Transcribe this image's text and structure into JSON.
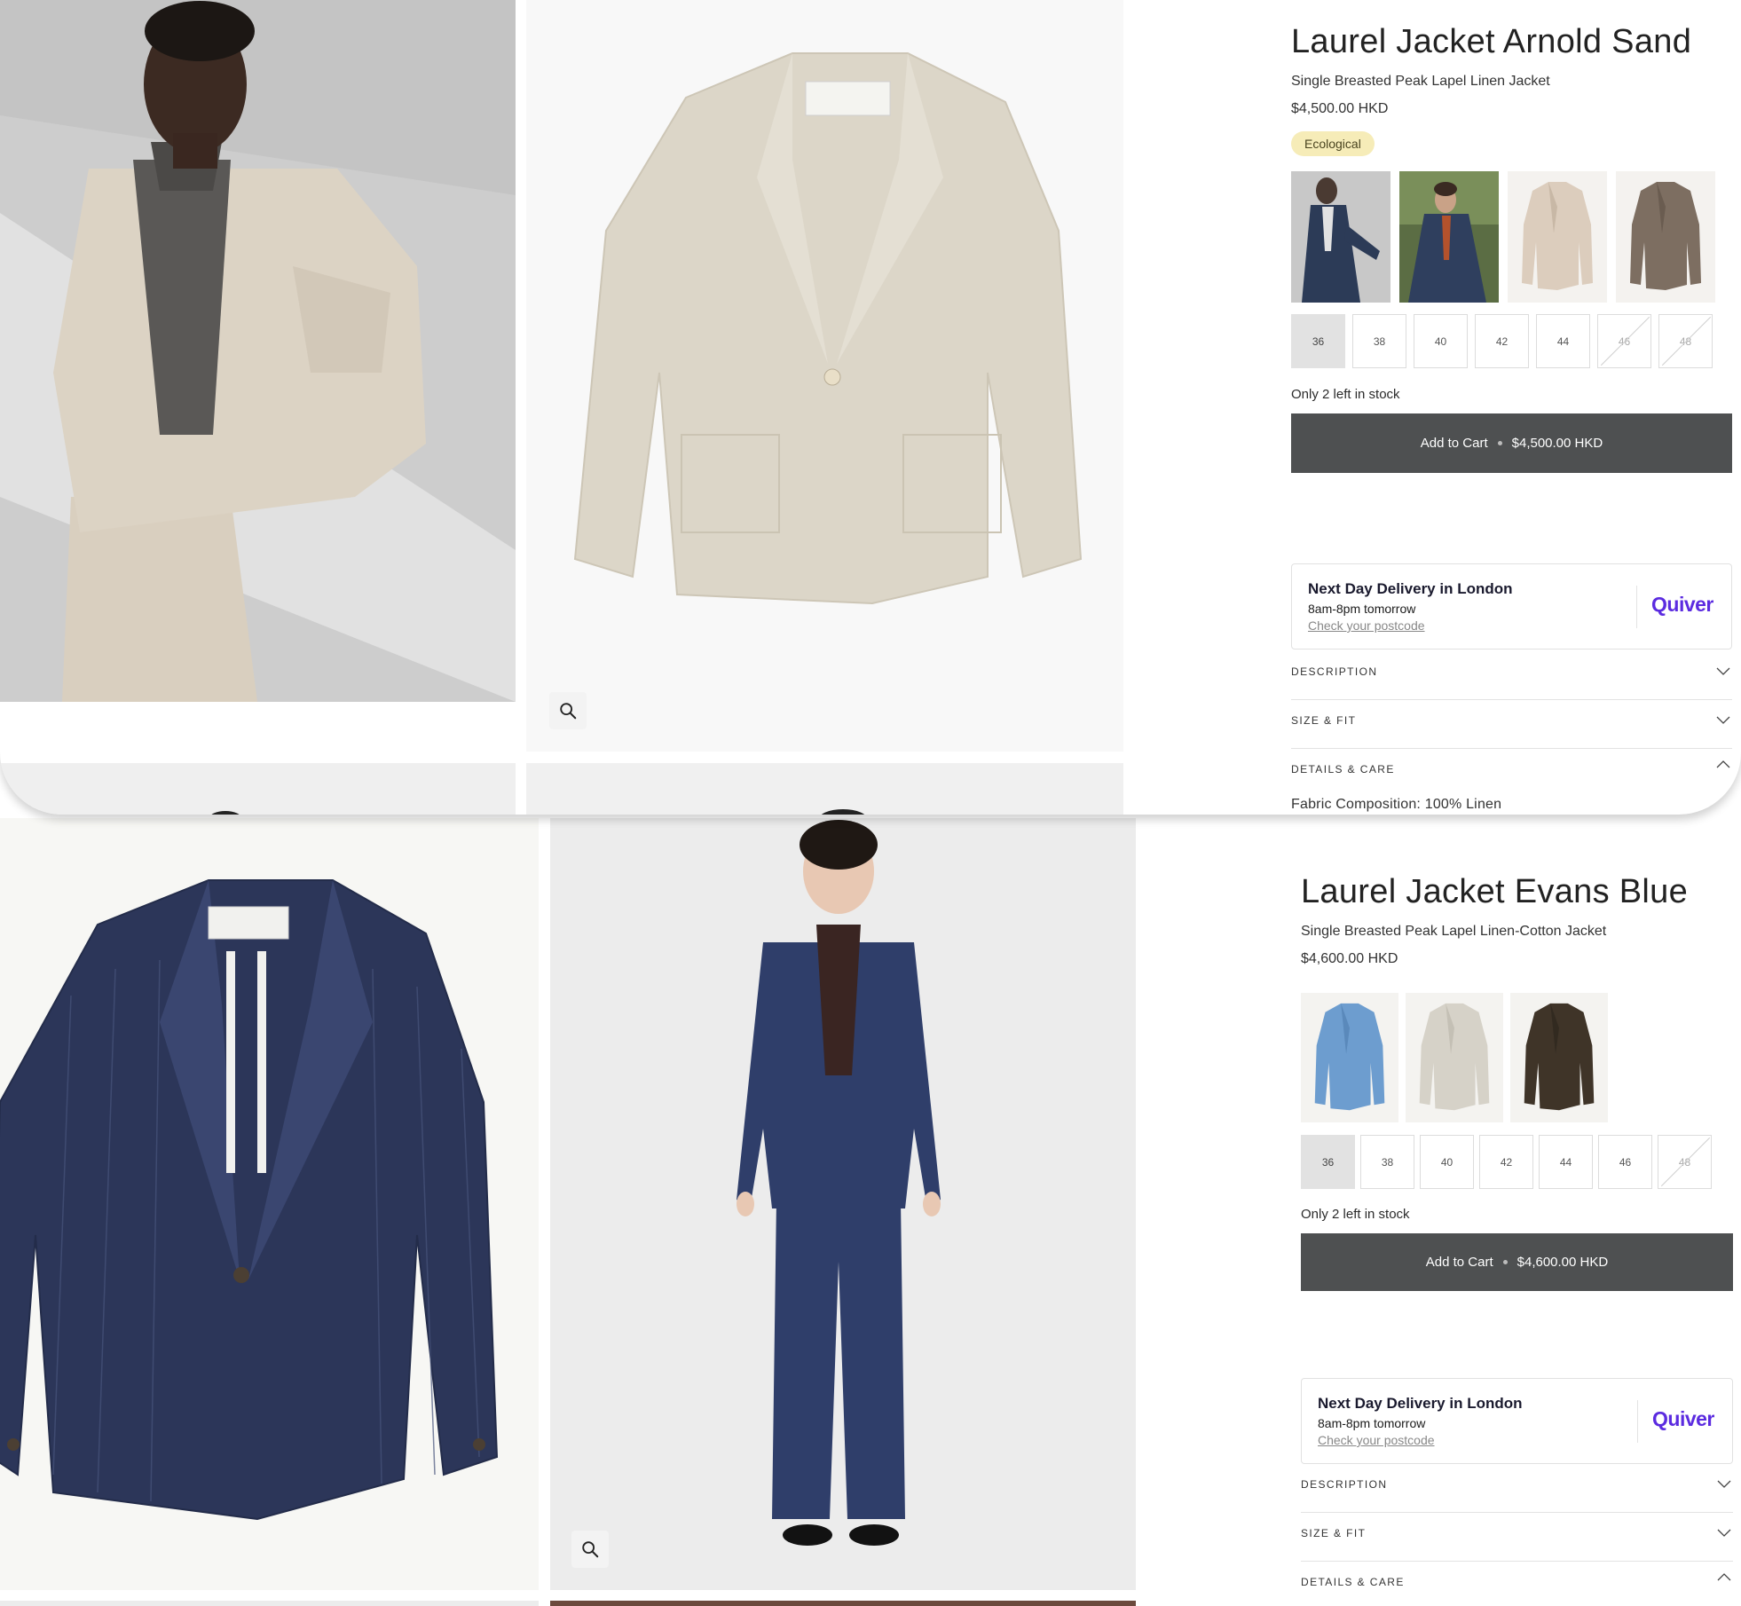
{
  "products": [
    {
      "title": "Laurel Jacket Arnold Sand",
      "subtitle": "Single Breasted Peak Lapel Linen Jacket",
      "price": "$4,500.00 HKD",
      "badge": "Ecological",
      "swatches": [
        "navy suit worn by model",
        "navy suit model seated outdoors",
        "beige jacket",
        "brown jacket"
      ],
      "sizes": [
        {
          "label": "36",
          "state": "selected"
        },
        {
          "label": "38",
          "state": "available"
        },
        {
          "label": "40",
          "state": "available"
        },
        {
          "label": "42",
          "state": "available"
        },
        {
          "label": "44",
          "state": "available"
        },
        {
          "label": "46",
          "state": "unavailable"
        },
        {
          "label": "48",
          "state": "unavailable"
        }
      ],
      "stock": "Only 2 left in stock",
      "cart_label": "Add to Cart",
      "cart_price": "$4,500.00 HKD",
      "delivery": {
        "title": "Next Day Delivery in London",
        "time": "8am-8pm tomorrow",
        "link": "Check your postcode",
        "logo": "Quiver"
      },
      "accordion": [
        "DESCRIPTION",
        "SIZE & FIT",
        "DETAILS & CARE"
      ],
      "fabric": "Fabric Composition: 100% Linen"
    },
    {
      "title": "Laurel Jacket Evans Blue",
      "subtitle": "Single Breasted Peak Lapel Linen-Cotton Jacket",
      "price": "$4,600.00 HKD",
      "swatches": [
        "light blue jacket",
        "stone jacket",
        "dark brown jacket"
      ],
      "sizes": [
        {
          "label": "36",
          "state": "selected"
        },
        {
          "label": "38",
          "state": "available"
        },
        {
          "label": "40",
          "state": "available"
        },
        {
          "label": "42",
          "state": "available"
        },
        {
          "label": "44",
          "state": "available"
        },
        {
          "label": "46",
          "state": "available"
        },
        {
          "label": "48",
          "state": "unavailable"
        }
      ],
      "stock": "Only 2 left in stock",
      "cart_label": "Add to Cart",
      "cart_price": "$4,600.00 HKD",
      "delivery": {
        "title": "Next Day Delivery in London",
        "time": "8am-8pm tomorrow",
        "link": "Check your postcode",
        "logo": "Quiver"
      },
      "accordion": [
        "DESCRIPTION",
        "SIZE & FIT",
        "DETAILS & CARE"
      ]
    }
  ],
  "icons": {
    "zoom": "magnifier-icon",
    "expand": "chevron-down-icon",
    "collapse": "chevron-up-icon"
  },
  "colors": {
    "cart_button": "#4e5051",
    "badge": "#f6ecb8",
    "quiver": "#5b2be0"
  }
}
